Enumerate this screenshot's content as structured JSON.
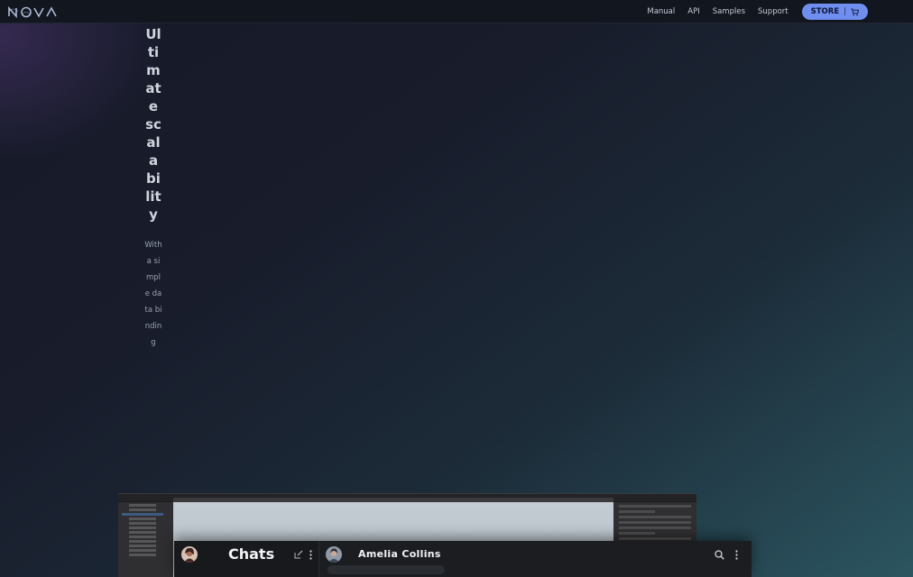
{
  "nav": {
    "logo_alt": "NOVA",
    "links": [
      "Manual",
      "API",
      "Samples",
      "Support"
    ],
    "store_label": "STORE",
    "store_separator": "|"
  },
  "hero": {
    "title": "Ultimate scalability",
    "subtitle": "With a simple data binding"
  },
  "chat_preview": {
    "panel_title": "Chats",
    "contact_name": "Amelia Collins"
  },
  "colors": {
    "accent": "#6f8ef0",
    "topbar": "#12161f",
    "chat_bg": "#1b1d21"
  },
  "icons": {
    "cart": "cart-icon",
    "edit": "edit-icon",
    "more": "more-vertical-icon",
    "search": "search-icon"
  }
}
